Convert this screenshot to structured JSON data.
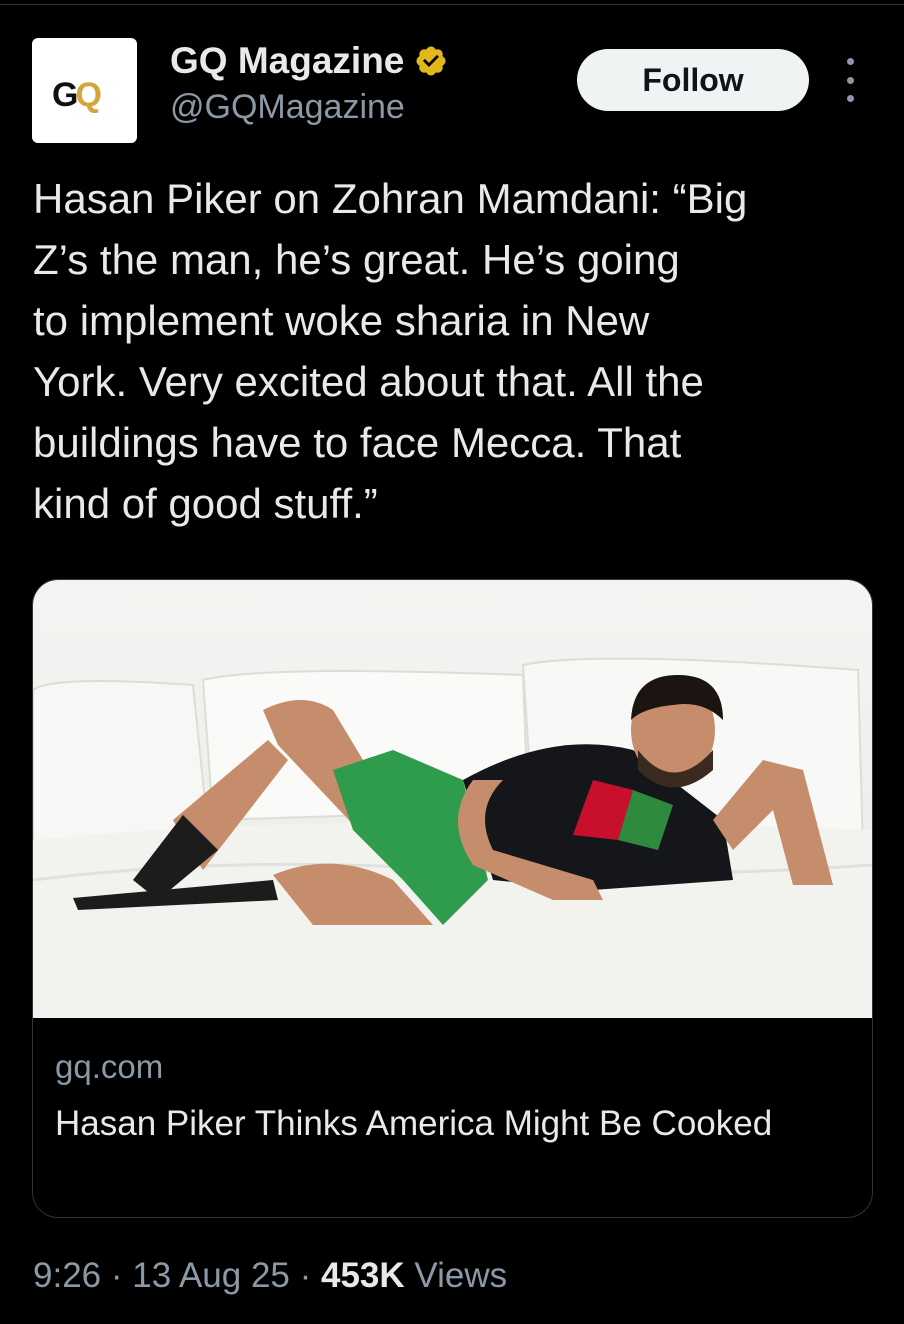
{
  "account": {
    "name": "GQ Magazine",
    "handle": "@GQMagazine",
    "avatar_logo": "GQ",
    "verified_color": "#e2b719"
  },
  "actions": {
    "follow_label": "Follow",
    "more_icon": "more-dots-icon"
  },
  "tweet": {
    "text": "Hasan Piker on Zohran Mamdani: “Big\nZ’s the man, he’s great. He’s going\nto implement woke sharia in New\nYork. Very excited about that. All the\nbuildings have to face Mecca. That\nkind of good stuff.”"
  },
  "card": {
    "domain": "gq.com",
    "title": "Hasan Piker Thinks America Might Be Cooked"
  },
  "meta": {
    "time": "9:26",
    "sep1": " · ",
    "date": "13 Aug 25",
    "sep2": " · ",
    "views_count": "453K",
    "views_label": " Views"
  }
}
